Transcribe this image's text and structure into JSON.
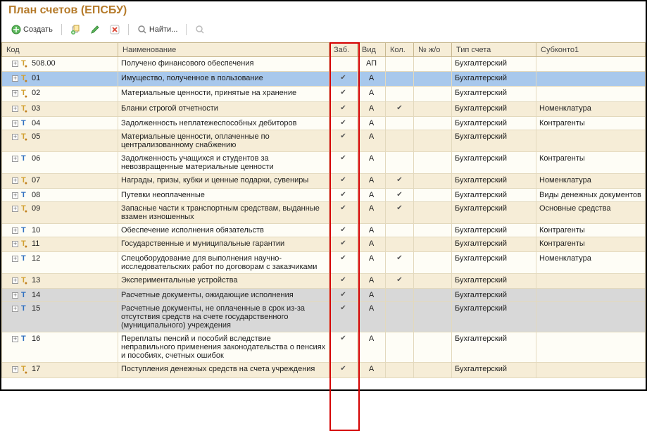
{
  "title": "План счетов (ЕПСБУ)",
  "toolbar": {
    "create": "Создать",
    "find": "Найти..."
  },
  "columns": {
    "code": "Код",
    "name": "Наименование",
    "zab": "Заб.",
    "vid": "Вид",
    "kol": "Кол.",
    "jo": "№ ж/о",
    "type": "Тип счета",
    "sub1": "Субконто1"
  },
  "rows": [
    {
      "code": "508.00",
      "yellow": true,
      "name": "Получено финансового обеспечения",
      "zab": "",
      "vid": "АП",
      "kol": "",
      "type": "Бухгалтерский",
      "sub": "",
      "sel": false
    },
    {
      "code": "01",
      "yellow": true,
      "name": "Имущество, полученное в пользование",
      "zab": "✔",
      "vid": "А",
      "kol": "",
      "type": "Бухгалтерский",
      "sub": "",
      "sel": true
    },
    {
      "code": "02",
      "yellow": true,
      "name": "Материальные ценности, принятые на хранение",
      "zab": "✔",
      "vid": "А",
      "kol": "",
      "type": "Бухгалтерский",
      "sub": ""
    },
    {
      "code": "03",
      "yellow": true,
      "name": "Бланки строгой отчетности",
      "zab": "✔",
      "vid": "А",
      "kol": "✔",
      "type": "Бухгалтерский",
      "sub": "Номенклатура"
    },
    {
      "code": "04",
      "yellow": false,
      "name": "Задолженность неплатежеспособных дебиторов",
      "zab": "✔",
      "vid": "А",
      "kol": "",
      "type": "Бухгалтерский",
      "sub": "Контрагенты"
    },
    {
      "code": "05",
      "yellow": true,
      "name": "Материальные ценности, оплаченные по централизованному снабжению",
      "zab": "✔",
      "vid": "А",
      "kol": "",
      "type": "Бухгалтерский",
      "sub": ""
    },
    {
      "code": "06",
      "yellow": false,
      "name": "Задолженность учащихся и студентов за невозвращенные материальные ценности",
      "zab": "✔",
      "vid": "А",
      "kol": "",
      "type": "Бухгалтерский",
      "sub": "Контрагенты"
    },
    {
      "code": "07",
      "yellow": true,
      "name": "Награды, призы, кубки и ценные подарки, сувениры",
      "zab": "✔",
      "vid": "А",
      "kol": "✔",
      "type": "Бухгалтерский",
      "sub": "Номенклатура"
    },
    {
      "code": "08",
      "yellow": false,
      "name": "Путевки неоплаченные",
      "zab": "✔",
      "vid": "А",
      "kol": "✔",
      "type": "Бухгалтерский",
      "sub": "Виды денежных документов"
    },
    {
      "code": "09",
      "yellow": true,
      "name": "Запасные части к транспортным средствам, выданные взамен изношенных",
      "zab": "✔",
      "vid": "А",
      "kol": "✔",
      "type": "Бухгалтерский",
      "sub": "Основные средства"
    },
    {
      "code": "10",
      "yellow": false,
      "name": "Обеспечение исполнения обязательств",
      "zab": "✔",
      "vid": "А",
      "kol": "",
      "type": "Бухгалтерский",
      "sub": "Контрагенты"
    },
    {
      "code": "11",
      "yellow": true,
      "name": "Государственные и муниципальные гарантии",
      "zab": "✔",
      "vid": "А",
      "kol": "",
      "type": "Бухгалтерский",
      "sub": "Контрагенты"
    },
    {
      "code": "12",
      "yellow": false,
      "name": "Спецоборудование для выполнения научно-исследовательских работ по договорам с заказчиками",
      "zab": "✔",
      "vid": "А",
      "kol": "✔",
      "type": "Бухгалтерский",
      "sub": "Номенклатура"
    },
    {
      "code": "13",
      "yellow": true,
      "name": "Экспериментальные устройства",
      "zab": "✔",
      "vid": "А",
      "kol": "✔",
      "type": "Бухгалтерский",
      "sub": ""
    },
    {
      "code": "14",
      "yellow": false,
      "name": "Расчетные документы, ожидающие исполнения",
      "zab": "✔",
      "vid": "А",
      "kol": "",
      "type": "Бухгалтерский",
      "sub": "",
      "gray": true
    },
    {
      "code": "15",
      "yellow": false,
      "name": "Расчетные документы, не оплаченные в срок из-за отсутствия средств на счете государственного (муниципального) учреждения",
      "zab": "✔",
      "vid": "А",
      "kol": "",
      "type": "Бухгалтерский",
      "sub": "",
      "gray": true
    },
    {
      "code": "16",
      "yellow": false,
      "name": "Переплаты пенсий и пособий вследствие неправильного применения законодательства о пенсиях и пособиях, счетных ошибок",
      "zab": "✔",
      "vid": "А",
      "kol": "",
      "type": "Бухгалтерский",
      "sub": ""
    },
    {
      "code": "17",
      "yellow": true,
      "name": "Поступления денежных средств на счета учреждения",
      "zab": "✔",
      "vid": "А",
      "kol": "",
      "type": "Бухгалтерский",
      "sub": ""
    }
  ]
}
